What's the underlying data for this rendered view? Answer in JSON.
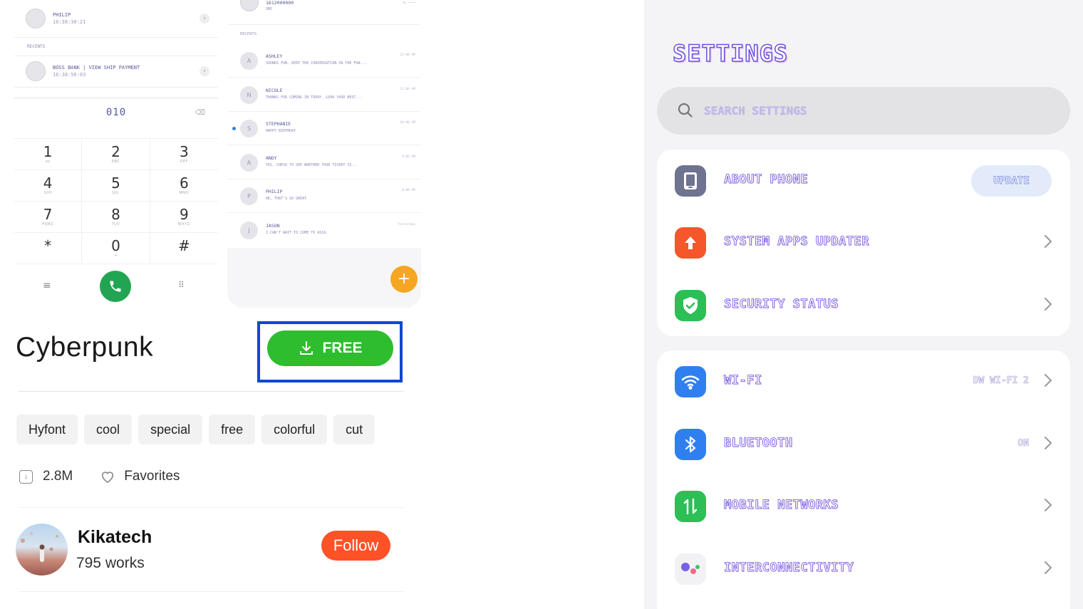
{
  "dialer_preview": {
    "contacts": [
      {
        "name": "PHILIP",
        "sub": "16:38:30:21"
      },
      {
        "name": "BOSS BANK | VIEW SHIP PAYMENT",
        "sub": "16:38:56:03"
      }
    ],
    "section_label": "RECENTS",
    "number": "010",
    "keys": [
      {
        "digit": "1",
        "letters": "oo"
      },
      {
        "digit": "2",
        "letters": "ABC"
      },
      {
        "digit": "3",
        "letters": "DEF"
      },
      {
        "digit": "4",
        "letters": "GHI"
      },
      {
        "digit": "5",
        "letters": "JKL"
      },
      {
        "digit": "6",
        "letters": "MNO"
      },
      {
        "digit": "7",
        "letters": "PQRS"
      },
      {
        "digit": "8",
        "letters": "TUV"
      },
      {
        "digit": "9",
        "letters": "WXYZ"
      },
      {
        "digit": "*",
        "letters": ""
      },
      {
        "digit": "0",
        "letters": "+"
      },
      {
        "digit": "#",
        "letters": ""
      }
    ]
  },
  "messages_preview": {
    "header_name": "1612000000",
    "header_sub": "SMS",
    "section_label": "RECENTS",
    "messages": [
      {
        "initial": "A",
        "name": "ASHLEY",
        "preview": "SOUNDS FUN. KEEP THE CONVERSATION IN THE FUN...",
        "time": "12:00 AM",
        "unread": false
      },
      {
        "initial": "N",
        "name": "NICOLE",
        "preview": "THANKS FOR COMING IN TODAY. LOOK YOUR BEST...",
        "time": "11:00 AM",
        "unread": false
      },
      {
        "initial": "S",
        "name": "STEPHANIE",
        "preview": "HAPPY BIRTHDAY",
        "time": "10:00 AM",
        "unread": true
      },
      {
        "initial": "A",
        "name": "ANDY",
        "preview": "YES. CHECK TO SEE WHETHER YOUR TICKET IS...",
        "time": "9:00 AM",
        "unread": false
      },
      {
        "initial": "P",
        "name": "PHILIP",
        "preview": "OK, THAT'S SO GREAT",
        "time": "8:00 AM",
        "unread": false
      },
      {
        "initial": "J",
        "name": "JASON",
        "preview": "I CAN'T WAIT TO COME TO ASIA.",
        "time": "Yesterday",
        "unread": false
      }
    ],
    "fab_label": "+"
  },
  "theme": {
    "title": "Cyberpunk",
    "download_label": "FREE",
    "tags": [
      "Hyfont",
      "cool",
      "special",
      "free",
      "colorful",
      "cut"
    ],
    "downloads": "2.8M",
    "favorites_label": "Favorites",
    "author_name": "Kikatech",
    "author_works": "795 works",
    "follow_label": "Follow"
  },
  "settings": {
    "title": "SETTINGS",
    "search_placeholder": "SEARCH SETTINGS",
    "group1": [
      {
        "label": "ABOUT PHONE",
        "action": "UPDATE",
        "icon": "phone-icon",
        "color": "#6e7390"
      },
      {
        "label": "SYSTEM APPS UPDATER",
        "icon": "arrow-up-icon",
        "color": "#f5562a"
      },
      {
        "label": "SECURITY STATUS",
        "icon": "shield-check-icon",
        "color": "#2bbf56"
      }
    ],
    "group2": [
      {
        "label": "WI-FI",
        "value": "DW WI-FI 2",
        "icon": "wifi-icon",
        "color": "#2f7ff0"
      },
      {
        "label": "BLUETOOTH",
        "value": "ON",
        "icon": "bluetooth-icon",
        "color": "#2f7ff0"
      },
      {
        "label": "MOBILE NETWORKS",
        "icon": "mobile-data-icon",
        "color": "#2bbf56"
      },
      {
        "label": "INTERCONNECTIVITY",
        "icon": "interconnect-icon",
        "color": "#f2f2f4"
      }
    ]
  }
}
